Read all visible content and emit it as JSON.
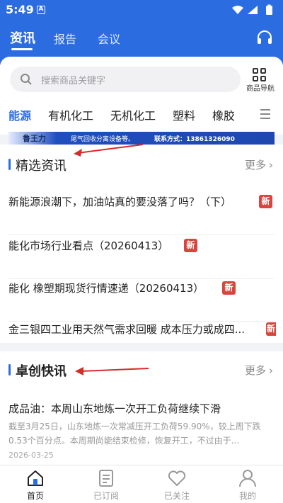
{
  "status_bar": {
    "time": "5:49",
    "a_indicator": "A",
    "icons": [
      "wifi-icon",
      "signal-icon",
      "battery-icon"
    ]
  },
  "top_tabs": [
    {
      "label": "资讯",
      "active": true
    },
    {
      "label": "报告",
      "active": false
    },
    {
      "label": "会议",
      "active": false
    }
  ],
  "search": {
    "placeholder": "搜索商品关键字"
  },
  "product_nav": {
    "label": "商品导航"
  },
  "categories": [
    {
      "label": "能源",
      "active": true
    },
    {
      "label": "有机化工",
      "active": false
    },
    {
      "label": "无机化工",
      "active": false
    },
    {
      "label": "塑料",
      "active": false
    },
    {
      "label": "橡胶",
      "active": false
    }
  ],
  "banner": {
    "brand": "鲁王力",
    "text1": "尾气回收分离设备等。",
    "text2": "联系方式：13861326090"
  },
  "section_selected": {
    "title": "精选资讯",
    "more": "更多",
    "items": [
      {
        "title": "新能源浪潮下，加油站真的要没落了吗？（下）",
        "badge": "新"
      },
      {
        "title": "能化市场行业看点（20260413）",
        "badge": "新"
      },
      {
        "title": "能化 橡塑期现货行情速递（20260413）",
        "badge": "新"
      },
      {
        "title": "金三银四工业用天然气需求回暖 成本压力或成四...",
        "badge": "新"
      }
    ]
  },
  "section_flash": {
    "title": "卓创快讯",
    "more": "更多",
    "item": {
      "title": "成品油：本周山东地炼一次开工负荷继续下滑",
      "body": "截至3月25日，山东地炼一次常减压开工负荷59.90%，较上周下跌0.53个百分点。本周期尚能结束检修，恢复开工，不过由于...",
      "date": "2026-03-25"
    }
  },
  "bottom_nav": [
    {
      "label": "首页",
      "icon": "home-icon",
      "active": true
    },
    {
      "label": "已订阅",
      "icon": "subscription-icon",
      "active": false
    },
    {
      "label": "已关注",
      "icon": "heart-icon",
      "active": false
    },
    {
      "label": "我的",
      "icon": "profile-icon",
      "active": false
    }
  ],
  "colors": {
    "brand_blue": "#2b6de0",
    "badge_red": "#d9453d",
    "arrow_red": "#d92a2a"
  }
}
